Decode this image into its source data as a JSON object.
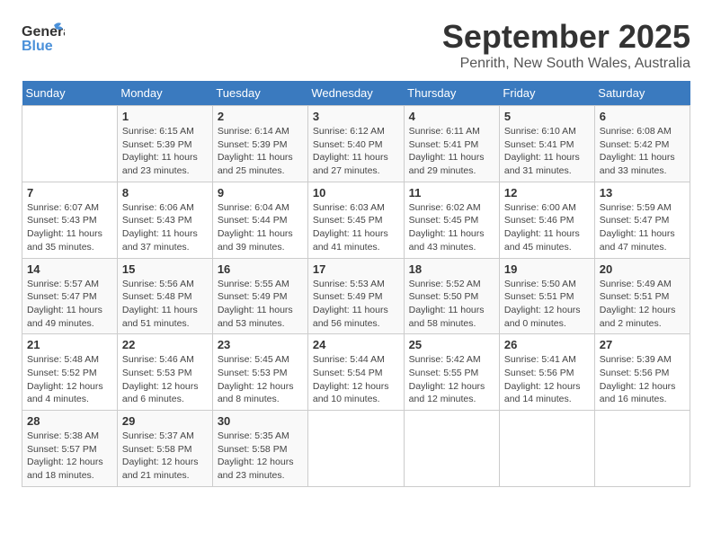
{
  "header": {
    "logo_line1": "General",
    "logo_line2": "Blue",
    "month": "September 2025",
    "location": "Penrith, New South Wales, Australia"
  },
  "days_of_week": [
    "Sunday",
    "Monday",
    "Tuesday",
    "Wednesday",
    "Thursday",
    "Friday",
    "Saturday"
  ],
  "weeks": [
    [
      {
        "num": "",
        "info": ""
      },
      {
        "num": "1",
        "info": "Sunrise: 6:15 AM\nSunset: 5:39 PM\nDaylight: 11 hours\nand 23 minutes."
      },
      {
        "num": "2",
        "info": "Sunrise: 6:14 AM\nSunset: 5:39 PM\nDaylight: 11 hours\nand 25 minutes."
      },
      {
        "num": "3",
        "info": "Sunrise: 6:12 AM\nSunset: 5:40 PM\nDaylight: 11 hours\nand 27 minutes."
      },
      {
        "num": "4",
        "info": "Sunrise: 6:11 AM\nSunset: 5:41 PM\nDaylight: 11 hours\nand 29 minutes."
      },
      {
        "num": "5",
        "info": "Sunrise: 6:10 AM\nSunset: 5:41 PM\nDaylight: 11 hours\nand 31 minutes."
      },
      {
        "num": "6",
        "info": "Sunrise: 6:08 AM\nSunset: 5:42 PM\nDaylight: 11 hours\nand 33 minutes."
      }
    ],
    [
      {
        "num": "7",
        "info": "Sunrise: 6:07 AM\nSunset: 5:43 PM\nDaylight: 11 hours\nand 35 minutes."
      },
      {
        "num": "8",
        "info": "Sunrise: 6:06 AM\nSunset: 5:43 PM\nDaylight: 11 hours\nand 37 minutes."
      },
      {
        "num": "9",
        "info": "Sunrise: 6:04 AM\nSunset: 5:44 PM\nDaylight: 11 hours\nand 39 minutes."
      },
      {
        "num": "10",
        "info": "Sunrise: 6:03 AM\nSunset: 5:45 PM\nDaylight: 11 hours\nand 41 minutes."
      },
      {
        "num": "11",
        "info": "Sunrise: 6:02 AM\nSunset: 5:45 PM\nDaylight: 11 hours\nand 43 minutes."
      },
      {
        "num": "12",
        "info": "Sunrise: 6:00 AM\nSunset: 5:46 PM\nDaylight: 11 hours\nand 45 minutes."
      },
      {
        "num": "13",
        "info": "Sunrise: 5:59 AM\nSunset: 5:47 PM\nDaylight: 11 hours\nand 47 minutes."
      }
    ],
    [
      {
        "num": "14",
        "info": "Sunrise: 5:57 AM\nSunset: 5:47 PM\nDaylight: 11 hours\nand 49 minutes."
      },
      {
        "num": "15",
        "info": "Sunrise: 5:56 AM\nSunset: 5:48 PM\nDaylight: 11 hours\nand 51 minutes."
      },
      {
        "num": "16",
        "info": "Sunrise: 5:55 AM\nSunset: 5:49 PM\nDaylight: 11 hours\nand 53 minutes."
      },
      {
        "num": "17",
        "info": "Sunrise: 5:53 AM\nSunset: 5:49 PM\nDaylight: 11 hours\nand 56 minutes."
      },
      {
        "num": "18",
        "info": "Sunrise: 5:52 AM\nSunset: 5:50 PM\nDaylight: 11 hours\nand 58 minutes."
      },
      {
        "num": "19",
        "info": "Sunrise: 5:50 AM\nSunset: 5:51 PM\nDaylight: 12 hours\nand 0 minutes."
      },
      {
        "num": "20",
        "info": "Sunrise: 5:49 AM\nSunset: 5:51 PM\nDaylight: 12 hours\nand 2 minutes."
      }
    ],
    [
      {
        "num": "21",
        "info": "Sunrise: 5:48 AM\nSunset: 5:52 PM\nDaylight: 12 hours\nand 4 minutes."
      },
      {
        "num": "22",
        "info": "Sunrise: 5:46 AM\nSunset: 5:53 PM\nDaylight: 12 hours\nand 6 minutes."
      },
      {
        "num": "23",
        "info": "Sunrise: 5:45 AM\nSunset: 5:53 PM\nDaylight: 12 hours\nand 8 minutes."
      },
      {
        "num": "24",
        "info": "Sunrise: 5:44 AM\nSunset: 5:54 PM\nDaylight: 12 hours\nand 10 minutes."
      },
      {
        "num": "25",
        "info": "Sunrise: 5:42 AM\nSunset: 5:55 PM\nDaylight: 12 hours\nand 12 minutes."
      },
      {
        "num": "26",
        "info": "Sunrise: 5:41 AM\nSunset: 5:56 PM\nDaylight: 12 hours\nand 14 minutes."
      },
      {
        "num": "27",
        "info": "Sunrise: 5:39 AM\nSunset: 5:56 PM\nDaylight: 12 hours\nand 16 minutes."
      }
    ],
    [
      {
        "num": "28",
        "info": "Sunrise: 5:38 AM\nSunset: 5:57 PM\nDaylight: 12 hours\nand 18 minutes."
      },
      {
        "num": "29",
        "info": "Sunrise: 5:37 AM\nSunset: 5:58 PM\nDaylight: 12 hours\nand 21 minutes."
      },
      {
        "num": "30",
        "info": "Sunrise: 5:35 AM\nSunset: 5:58 PM\nDaylight: 12 hours\nand 23 minutes."
      },
      {
        "num": "",
        "info": ""
      },
      {
        "num": "",
        "info": ""
      },
      {
        "num": "",
        "info": ""
      },
      {
        "num": "",
        "info": ""
      }
    ]
  ]
}
